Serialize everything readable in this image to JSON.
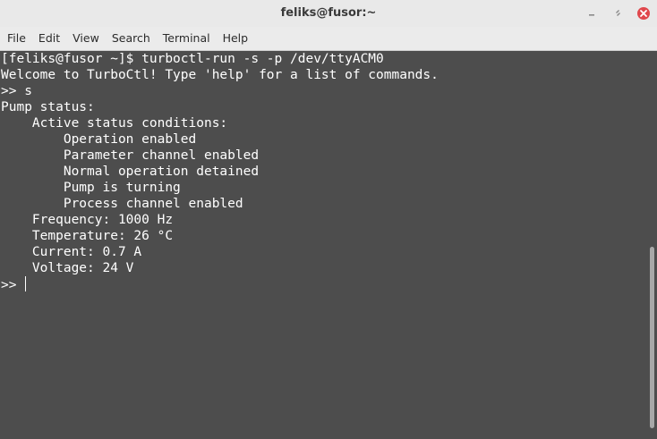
{
  "window": {
    "title": "feliks@fusor:~"
  },
  "window_controls": {
    "minimize_icon": "minimize-icon",
    "maximize_icon": "maximize-icon",
    "close_icon": "close-icon",
    "close_color": "#e0474c"
  },
  "menu": {
    "items": [
      "File",
      "Edit",
      "View",
      "Search",
      "Terminal",
      "Help"
    ]
  },
  "terminal": {
    "lines": [
      "[feliks@fusor ~]$ turboctl-run -s -p /dev/ttyACM0",
      "Welcome to TurboCtl! Type 'help' for a list of commands.",
      ">> s",
      "Pump status:",
      "    Active status conditions:",
      "        Operation enabled",
      "        Parameter channel enabled",
      "        Normal operation detained",
      "        Pump is turning",
      "        Process channel enabled",
      "    Frequency: 1000 Hz",
      "    Temperature: 26 °C",
      "    Current: 0.7 A",
      "    Voltage: 24 V"
    ],
    "prompt": ">>",
    "background": "#4d4d4d",
    "foreground": "#ffffff"
  }
}
